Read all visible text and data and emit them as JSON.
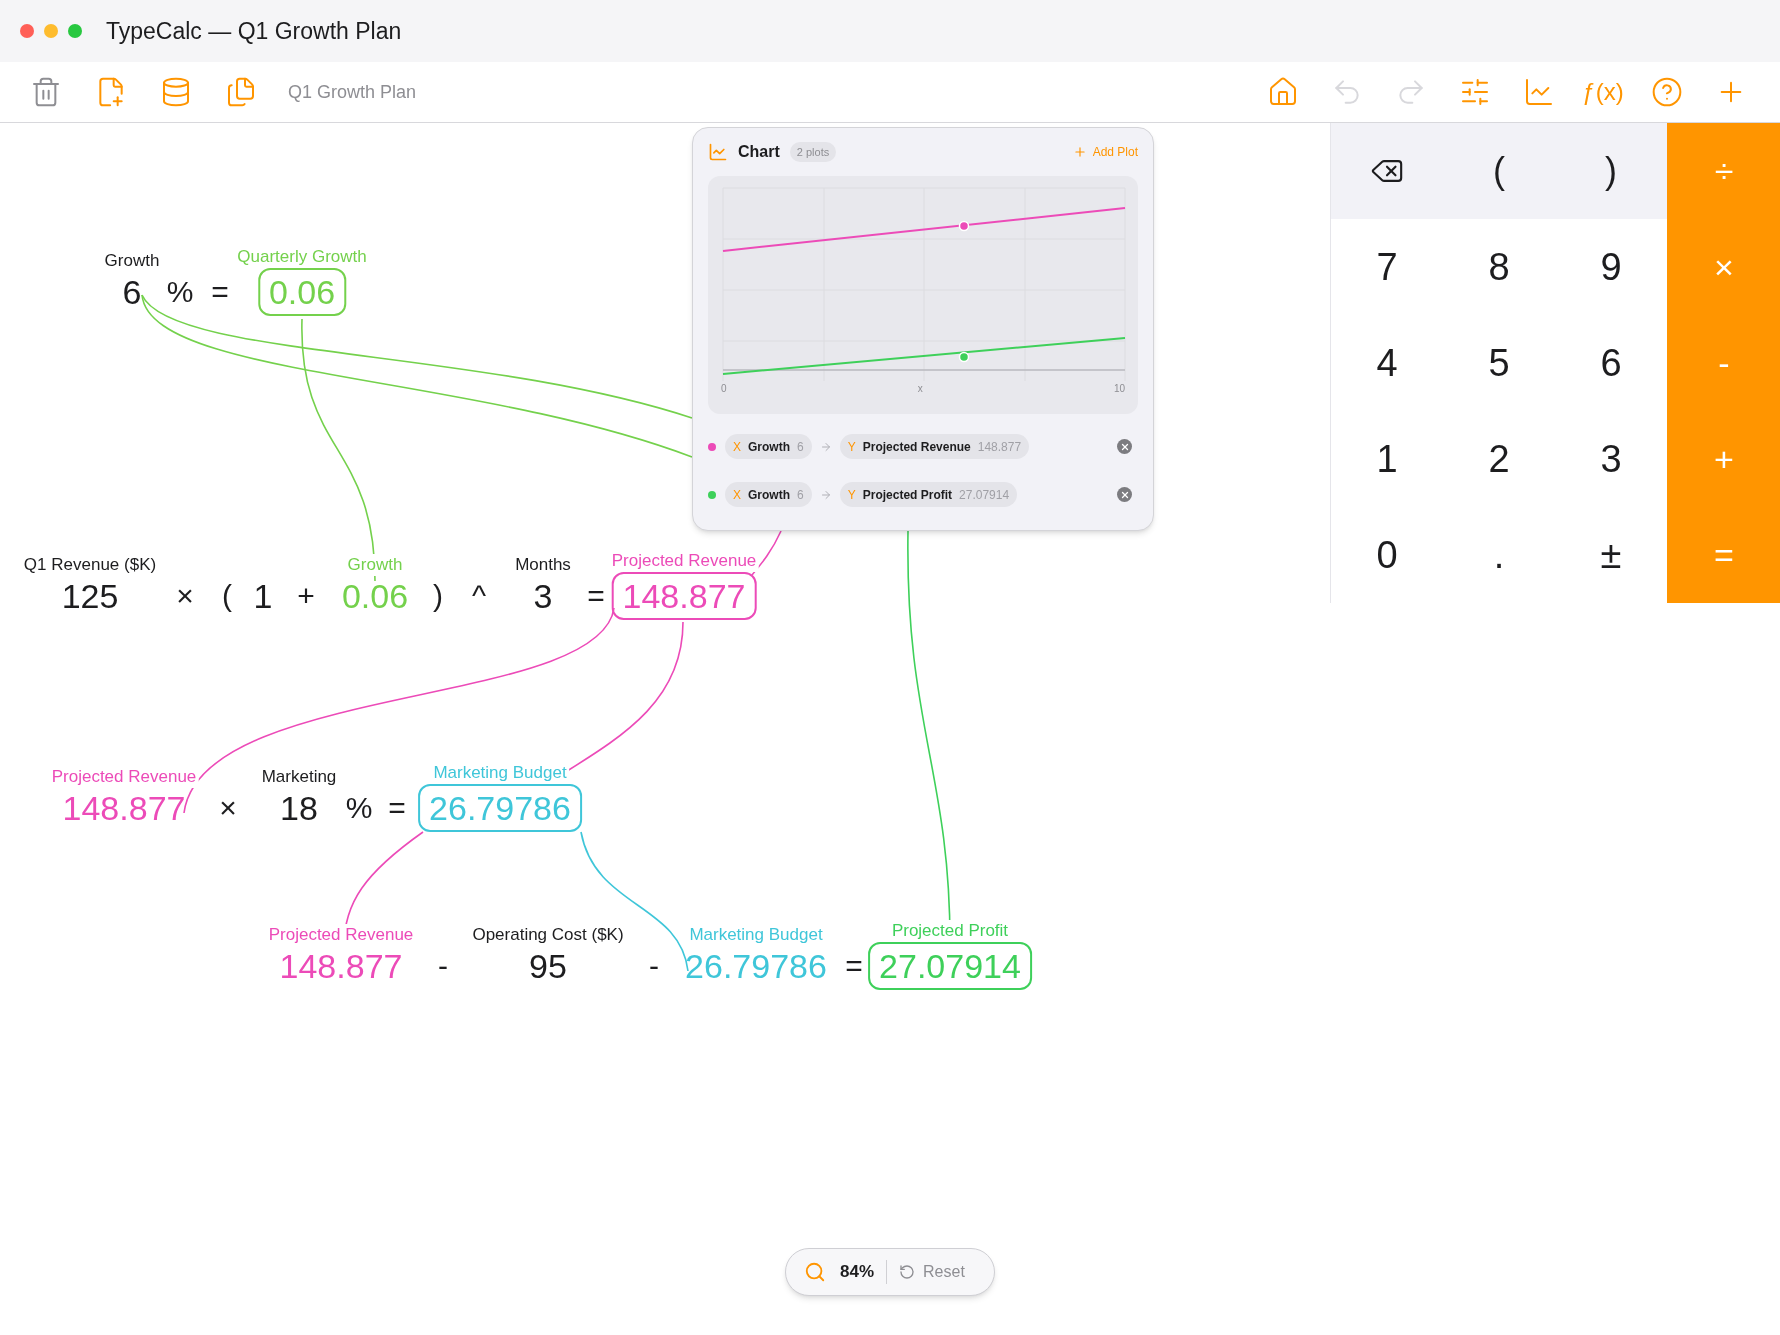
{
  "window": {
    "title": "TypeCalc — Q1 Growth Plan"
  },
  "toolbar": {
    "document_title": "Q1 Growth Plan",
    "left_buttons": [
      {
        "disabled": true
      },
      {
        "disabled": false
      },
      {
        "disabled": false
      },
      {
        "disabled": false
      }
    ],
    "right_buttons": [
      {
        "disabled": false
      },
      {
        "disabled": true
      },
      {
        "disabled": true
      },
      {
        "disabled": false
      },
      {
        "disabled": false
      },
      {
        "disabled": false,
        "label": "ƒ(x)"
      },
      {
        "disabled": false
      },
      {
        "disabled": false
      }
    ]
  },
  "equations": [
    {
      "tokens": [
        {
          "kind": "value",
          "label": "Growth",
          "value": "6"
        },
        {
          "kind": "operator",
          "value": "%"
        },
        {
          "kind": "operator",
          "value": "="
        },
        {
          "kind": "result",
          "label": "Quarterly Growth",
          "value": "0.06",
          "color": "#74d14c"
        }
      ]
    },
    {
      "tokens": [
        {
          "kind": "value",
          "label": "Q1 Revenue ($K)",
          "value": "125"
        },
        {
          "kind": "operator",
          "value": "×"
        },
        {
          "kind": "operator",
          "value": "("
        },
        {
          "kind": "value",
          "value": "1"
        },
        {
          "kind": "operator",
          "value": "+"
        },
        {
          "kind": "reference",
          "label": "Growth",
          "value": "0.06",
          "color": "#74d14c"
        },
        {
          "kind": "operator",
          "value": ")"
        },
        {
          "kind": "operator",
          "value": "^"
        },
        {
          "kind": "value",
          "label": "Months",
          "value": "3"
        },
        {
          "kind": "operator",
          "value": "="
        },
        {
          "kind": "result",
          "label": "Projected Revenue",
          "value": "148.877",
          "color": "#ec4bb8"
        }
      ]
    },
    {
      "tokens": [
        {
          "kind": "reference",
          "label": "Projected Revenue",
          "value": "148.877",
          "color": "#ec4bb8"
        },
        {
          "kind": "operator",
          "value": "×"
        },
        {
          "kind": "value",
          "label": "Marketing",
          "value": "18"
        },
        {
          "kind": "operator",
          "value": "%"
        },
        {
          "kind": "operator",
          "value": "="
        },
        {
          "kind": "result",
          "label": "Marketing Budget",
          "value": "26.79786",
          "color": "#3fc6d9"
        }
      ]
    },
    {
      "tokens": [
        {
          "kind": "reference",
          "label": "Projected Revenue",
          "value": "148.877",
          "color": "#ec4bb8"
        },
        {
          "kind": "operator",
          "value": "-"
        },
        {
          "kind": "value",
          "label": "Operating Cost ($K)",
          "value": "95"
        },
        {
          "kind": "operator",
          "value": "-"
        },
        {
          "kind": "reference",
          "label": "Marketing Budget",
          "value": "26.79786",
          "color": "#3fc6d9"
        },
        {
          "kind": "operator",
          "value": "="
        },
        {
          "kind": "result",
          "label": "Projected Profit",
          "value": "27.07914",
          "color": "#3ed05a"
        }
      ]
    }
  ],
  "chart": {
    "title": "Chart",
    "badge": "2 plots",
    "add_label": "Add Plot",
    "axis_labels": [
      "0",
      "x",
      "10"
    ],
    "plots": [
      {
        "color": "#ec4bb8",
        "x": {
          "axis": "X",
          "name": "Growth",
          "value": "6"
        },
        "y": {
          "axis": "Y",
          "name": "Projected Revenue",
          "value": "148.877"
        }
      },
      {
        "color": "#3ed05a",
        "x": {
          "axis": "X",
          "name": "Growth",
          "value": "6"
        },
        "y": {
          "axis": "Y",
          "name": "Projected Profit",
          "value": "27.07914"
        }
      }
    ]
  },
  "keypad": [
    [
      {
        "kind": "backspace"
      },
      {
        "kind": "function",
        "label": "("
      },
      {
        "kind": "function",
        "label": ")"
      },
      {
        "kind": "operator",
        "label": "÷"
      }
    ],
    [
      {
        "kind": "digit",
        "label": "7"
      },
      {
        "kind": "digit",
        "label": "8"
      },
      {
        "kind": "digit",
        "label": "9"
      },
      {
        "kind": "operator",
        "label": "×"
      }
    ],
    [
      {
        "kind": "digit",
        "label": "4"
      },
      {
        "kind": "digit",
        "label": "5"
      },
      {
        "kind": "digit",
        "label": "6"
      },
      {
        "kind": "operator",
        "label": "-"
      }
    ],
    [
      {
        "kind": "digit",
        "label": "1"
      },
      {
        "kind": "digit",
        "label": "2"
      },
      {
        "kind": "digit",
        "label": "3"
      },
      {
        "kind": "operator",
        "label": "+"
      }
    ],
    [
      {
        "kind": "digit",
        "label": "0"
      },
      {
        "kind": "digit",
        "label": "."
      },
      {
        "kind": "digit",
        "label": "±"
      },
      {
        "kind": "operator",
        "label": "="
      }
    ]
  ],
  "zoom": {
    "value": "84%",
    "reset_label": "Reset"
  }
}
